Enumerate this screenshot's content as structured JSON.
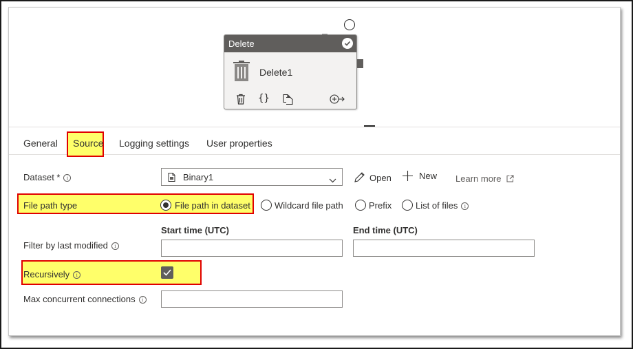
{
  "node": {
    "title": "Delete",
    "name": "Delete1",
    "actions": {
      "delete_icon": "trash-icon",
      "code_icon": "{}",
      "copy_icon": "copy-icon",
      "output_icon": "⊕→"
    }
  },
  "tabs": [
    {
      "label": "General"
    },
    {
      "label": "Source",
      "selected": true
    },
    {
      "label": "Logging settings"
    },
    {
      "label": "User properties"
    }
  ],
  "form": {
    "dataset_label": "Dataset *",
    "dataset_value": "Binary1",
    "open_label": "Open",
    "new_label": "New",
    "learn_more_label": "Learn more",
    "file_path_type_label": "File path type",
    "file_path_options": [
      {
        "label": "File path in dataset",
        "checked": true
      },
      {
        "label": "Wildcard file path",
        "checked": false
      },
      {
        "label": "Prefix",
        "checked": false
      },
      {
        "label": "List of files",
        "checked": false
      }
    ],
    "start_time_label": "Start time (UTC)",
    "end_time_label": "End time (UTC)",
    "filter_label": "Filter by last modified",
    "start_time_value": "",
    "end_time_value": "",
    "recursively_label": "Recursively",
    "recursively_checked": true,
    "max_connections_label": "Max concurrent connections",
    "max_connections_value": ""
  },
  "colors": {
    "highlight_fill": "#ffff6a",
    "highlight_border": "#e00000",
    "node_header": "#605e5c",
    "accent": "#0078d4"
  }
}
